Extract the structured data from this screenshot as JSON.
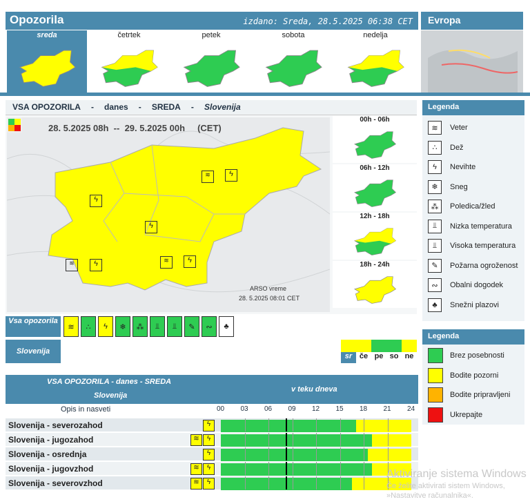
{
  "header": {
    "title": "Opozorila",
    "issued": "izdano: Sreda, 28.5.2025 06:38 CET",
    "europe": "Evropa"
  },
  "days": [
    {
      "label": "sreda",
      "fill": "#ffff00"
    },
    {
      "label": "četrtek",
      "fill": "mixed"
    },
    {
      "label": "petek",
      "fill": "#2ecc52"
    },
    {
      "label": "sobota",
      "fill": "#2ecc52"
    },
    {
      "label": "nedelja",
      "fill": "mixed"
    }
  ],
  "main": {
    "title_a": "VSA OPOZORILA",
    "title_b": "danes",
    "title_c": "SREDA",
    "title_d": "Slovenija",
    "sep": "-",
    "period": "28. 5.2025 08h  --  29. 5.2025 00h     (CET)",
    "credit": "ARSO vreme",
    "credit_time": "28. 5.2025  08:01 CET"
  },
  "slots": [
    "00h - 06h",
    "06h - 12h",
    "12h - 18h",
    "18h - 24h"
  ],
  "legend": {
    "title": "Legenda",
    "items": [
      "Veter",
      "Dež",
      "Nevihte",
      "Sneg",
      "Poledica/žled",
      "Nizka temperatura",
      "Visoka temperatura",
      "Požarna ogroženost",
      "Obalni dogodek",
      "Snežni plazovi"
    ],
    "title2": "Legenda",
    "levels": [
      {
        "label": "Brez posebnosti",
        "color": "#2ecc52"
      },
      {
        "label": "Bodite pozorni",
        "color": "#ffff00"
      },
      {
        "label": "Bodite pripravljeni",
        "color": "#ffb300"
      },
      {
        "label": "Ukrepajte",
        "color": "#ee1111"
      }
    ]
  },
  "rows": {
    "vsa": "Vsa opozorila",
    "slo": "Slovenija",
    "days": [
      "sr",
      "če",
      "pe",
      "so",
      "ne"
    ]
  },
  "table": {
    "title": "VSA OPOZORILA - danes - SREDA",
    "subtitle": "Slovenija",
    "time_hdr": "v teku dneva",
    "desc": "Opis in nasveti",
    "hours": [
      "00",
      "03",
      "06",
      "09",
      "12",
      "15",
      "18",
      "21",
      "24"
    ],
    "regions": [
      {
        "name": "Slovenija - severozahod",
        "icons": [
          "Nevihte"
        ],
        "yellow_from": 17
      },
      {
        "name": "Slovenija - jugozahod",
        "icons": [
          "Veter",
          "Nevihte"
        ],
        "yellow_from": 19
      },
      {
        "name": "Slovenija - osrednja",
        "icons": [
          "Nevihte"
        ],
        "yellow_from": 18.5
      },
      {
        "name": "Slovenija - jugovzhod",
        "icons": [
          "Veter",
          "Nevihte"
        ],
        "yellow_from": 19
      },
      {
        "name": "Slovenija - severovzhod",
        "icons": [
          "Veter",
          "Nevihte"
        ],
        "yellow_from": 16.5
      }
    ]
  },
  "watermark": {
    "line1": "Aktiviranje sistema Windows",
    "line2": "Če želite aktivirati sistem Windows,",
    "line3": "»Nastavitve računalnika«."
  }
}
